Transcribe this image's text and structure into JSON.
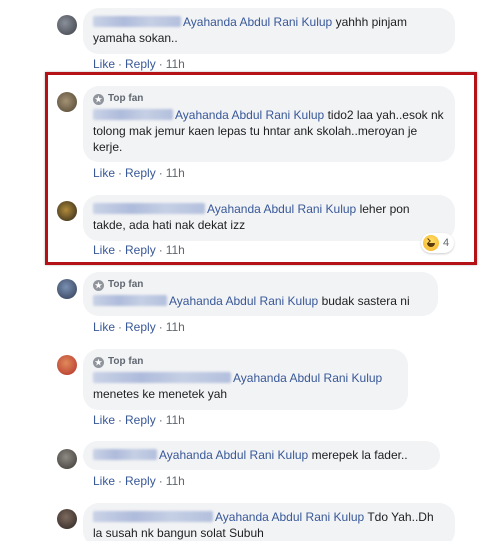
{
  "badges": {
    "top_fan": "Top fan"
  },
  "reactions": {
    "count": "4",
    "icon": "haha-emoji-icon"
  },
  "highlight_color": "#b41217",
  "link_color": "#385898",
  "comments": [
    {
      "mention": "Ayahanda Abdul Rani Kulup",
      "text": " yahhh pinjam yamaha sokan..",
      "actions": {
        "like": "Like",
        "reply": "Reply",
        "time": "11h"
      }
    },
    {
      "badge": "Top fan",
      "mention": "Ayahanda Abdul Rani Kulup",
      "text": " tido2 laa yah..esok nk tolong mak jemur kaen lepas tu hntar ank skolah..meroyan je kerje.",
      "actions": {
        "like": "Like",
        "reply": "Reply",
        "time": "11h"
      }
    },
    {
      "mention": "Ayahanda Abdul Rani Kulup",
      "text": " leher pon takde, ada hati nak dekat izz",
      "actions": {
        "like": "Like",
        "reply": "Reply",
        "time": "11h"
      }
    },
    {
      "badge": "Top fan",
      "mention": "Ayahanda Abdul Rani Kulup",
      "text": " budak sastera ni",
      "actions": {
        "like": "Like",
        "reply": "Reply",
        "time": "11h"
      }
    },
    {
      "badge": "Top fan",
      "mention": "Ayahanda Abdul Rani Kulup",
      "text": " menetes ke menetek yah",
      "actions": {
        "like": "Like",
        "reply": "Reply",
        "time": "11h"
      }
    },
    {
      "mention": "Ayahanda Abdul Rani Kulup",
      "text": " merepek la fader..",
      "actions": {
        "like": "Like",
        "reply": "Reply",
        "time": "11h"
      }
    },
    {
      "mention": "Ayahanda Abdul Rani Kulup",
      "text": " Tdo Yah..Dh la susah nk bangun solat Subuh"
    }
  ]
}
